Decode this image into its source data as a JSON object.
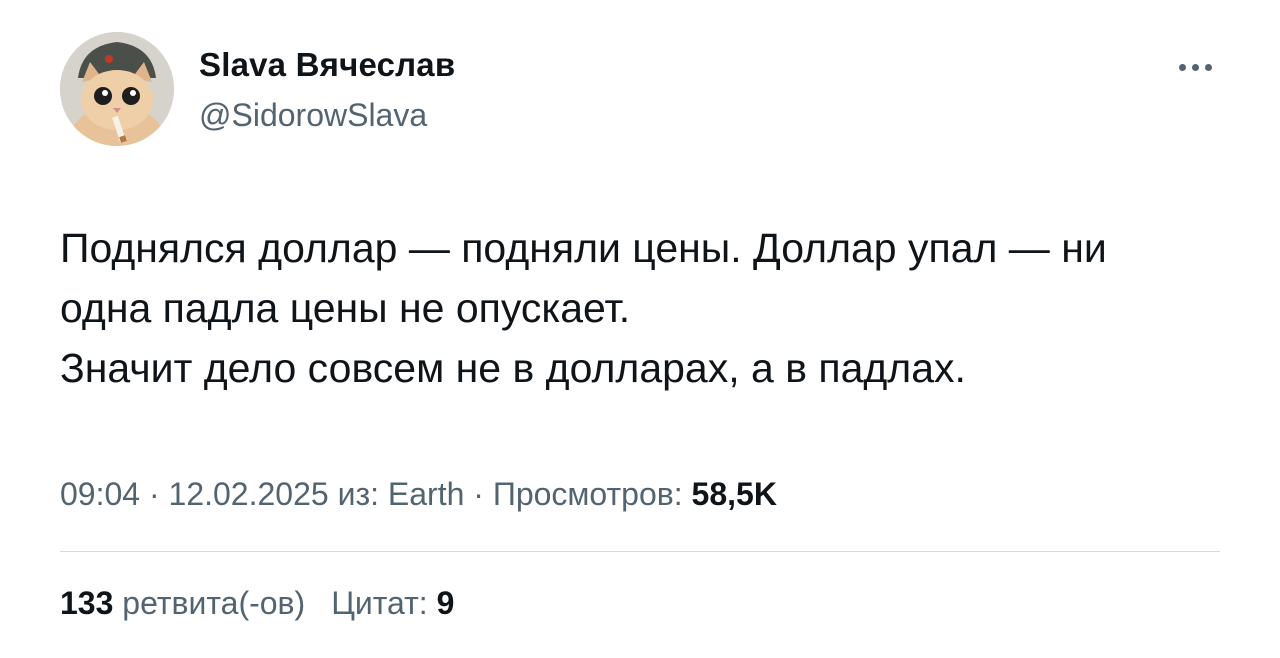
{
  "author": {
    "display_name": "Slava Вячеслав",
    "handle": "@SidorowSlava",
    "avatar": "cat-with-cigarette-and-ushanka-avatar"
  },
  "menu": {
    "icon": "more-dots-icon"
  },
  "tweet": {
    "lines": [
      "Поднялся доллар — подняли цены. Доллар упал — ни",
      "одна падла цены не опускает.",
      "Значит дело совсем не в долларах, а в падлах."
    ]
  },
  "meta": {
    "time": "09:04",
    "separator1": " · ",
    "date": "12.02.2025",
    "source_prefix": " из: ",
    "source": "Earth",
    "separator2": " · ",
    "views_label": "Просмотров: ",
    "views_count": "58,5K"
  },
  "stats": {
    "retweets_count": "133",
    "retweets_label": " ретвита(-ов)",
    "quotes_label": "Цитат: ",
    "quotes_count": "9"
  },
  "colors": {
    "text_primary": "#0f1419",
    "text_secondary": "#536471",
    "divider": "#cfd9de",
    "background": "#ffffff"
  }
}
